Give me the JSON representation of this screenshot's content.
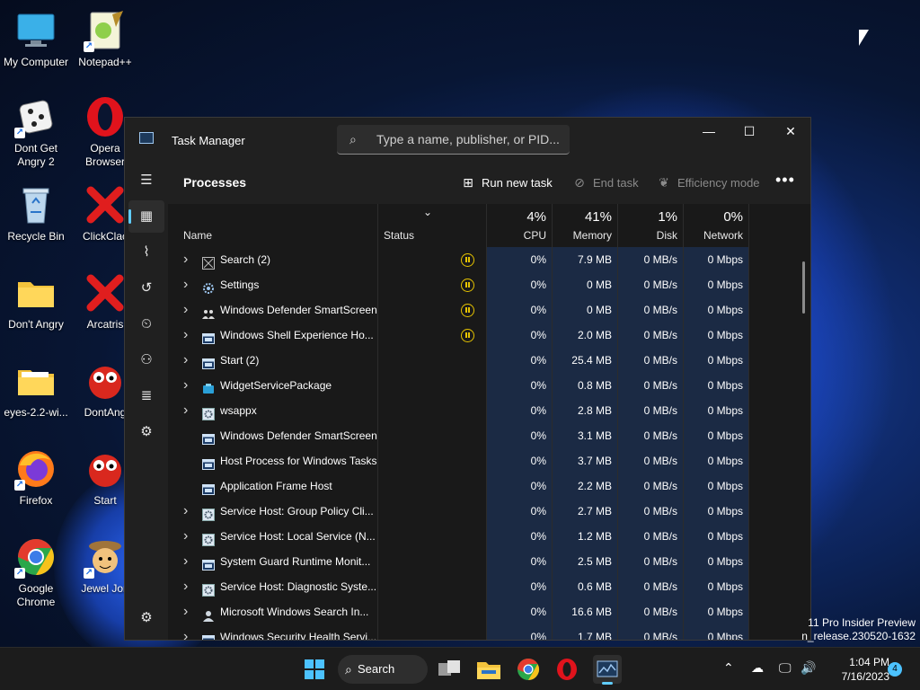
{
  "desktop": {
    "icons": [
      {
        "label": "My Computer"
      },
      {
        "label": "Notepad++"
      },
      {
        "label": "Dont Get Angry 2"
      },
      {
        "label": "Opera Browser"
      },
      {
        "label": "Recycle Bin"
      },
      {
        "label": "ClickClac"
      },
      {
        "label": "Don't Angry"
      },
      {
        "label": "Arcatris"
      },
      {
        "label": "eyes-2.2-wi..."
      },
      {
        "label": "DontAng"
      },
      {
        "label": "Firefox"
      },
      {
        "label": "Start"
      },
      {
        "label": "Google Chrome"
      },
      {
        "label": "Jewel Jon"
      }
    ],
    "watermark_line1": "11 Pro Insider Preview",
    "watermark_line2": "n_release.230520-1632"
  },
  "window": {
    "title": "Task Manager",
    "search_placeholder": "Type a name, publisher, or PID...",
    "minimize": "—",
    "maximize": "☐",
    "close": "✕"
  },
  "nav": {
    "items": [
      "menu-icon",
      "processes-icon",
      "performance-icon",
      "app-history-icon",
      "startup-apps-icon",
      "users-icon",
      "details-icon",
      "services-icon",
      "settings-icon"
    ]
  },
  "toolbar": {
    "heading": "Processes",
    "run_new_task": "Run new task",
    "end_task": "End task",
    "efficiency_mode": "Efficiency mode",
    "more": "•••"
  },
  "columns": {
    "name": "Name",
    "status": "Status",
    "cpu_pct": "4%",
    "cpu": "CPU",
    "memory_pct": "41%",
    "memory": "Memory",
    "disk_pct": "1%",
    "disk": "Disk",
    "network_pct": "0%",
    "network": "Network"
  },
  "processes": [
    {
      "name": "Search (2)",
      "expandable": true,
      "suspended": true,
      "icon": "search-app-icon",
      "cpu": "0%",
      "memory": "7.9 MB",
      "disk": "0 MB/s",
      "network": "0 Mbps"
    },
    {
      "name": "Settings",
      "expandable": true,
      "suspended": true,
      "icon": "settings-app-icon",
      "cpu": "0%",
      "memory": "0 MB",
      "disk": "0 MB/s",
      "network": "0 Mbps"
    },
    {
      "name": "Windows Defender SmartScreen",
      "expandable": true,
      "suspended": true,
      "icon": "defender-icon",
      "cpu": "0%",
      "memory": "0 MB",
      "disk": "0 MB/s",
      "network": "0 Mbps"
    },
    {
      "name": "Windows Shell Experience Ho...",
      "expandable": true,
      "suspended": true,
      "icon": "window-app-icon",
      "cpu": "0%",
      "memory": "2.0 MB",
      "disk": "0 MB/s",
      "network": "0 Mbps"
    },
    {
      "name": "Start (2)",
      "expandable": true,
      "suspended": false,
      "icon": "window-app-icon",
      "cpu": "0%",
      "memory": "25.4 MB",
      "disk": "0 MB/s",
      "network": "0 Mbps"
    },
    {
      "name": "WidgetServicePackage",
      "expandable": true,
      "suspended": false,
      "icon": "widget-icon",
      "cpu": "0%",
      "memory": "0.8 MB",
      "disk": "0 MB/s",
      "network": "0 Mbps"
    },
    {
      "name": "wsappx",
      "expandable": true,
      "suspended": false,
      "icon": "service-gear-icon",
      "cpu": "0%",
      "memory": "2.8 MB",
      "disk": "0 MB/s",
      "network": "0 Mbps"
    },
    {
      "name": "Windows Defender SmartScreen",
      "expandable": false,
      "suspended": false,
      "icon": "window-app-icon",
      "cpu": "0%",
      "memory": "3.1 MB",
      "disk": "0 MB/s",
      "network": "0 Mbps"
    },
    {
      "name": "Host Process for Windows Tasks",
      "expandable": false,
      "suspended": false,
      "icon": "window-app-icon",
      "cpu": "0%",
      "memory": "3.7 MB",
      "disk": "0 MB/s",
      "network": "0 Mbps"
    },
    {
      "name": "Application Frame Host",
      "expandable": false,
      "suspended": false,
      "icon": "window-app-icon",
      "cpu": "0%",
      "memory": "2.2 MB",
      "disk": "0 MB/s",
      "network": "0 Mbps"
    },
    {
      "name": "Service Host: Group Policy Cli...",
      "expandable": true,
      "suspended": false,
      "icon": "service-gear-icon",
      "cpu": "0%",
      "memory": "2.7 MB",
      "disk": "0 MB/s",
      "network": "0 Mbps"
    },
    {
      "name": "Service Host: Local Service (N...",
      "expandable": true,
      "suspended": false,
      "icon": "service-gear-icon",
      "cpu": "0%",
      "memory": "1.2 MB",
      "disk": "0 MB/s",
      "network": "0 Mbps"
    },
    {
      "name": "System Guard Runtime Monit...",
      "expandable": true,
      "suspended": false,
      "icon": "window-app-icon",
      "cpu": "0%",
      "memory": "2.5 MB",
      "disk": "0 MB/s",
      "network": "0 Mbps"
    },
    {
      "name": "Service Host: Diagnostic Syste...",
      "expandable": true,
      "suspended": false,
      "icon": "service-gear-icon",
      "cpu": "0%",
      "memory": "0.6 MB",
      "disk": "0 MB/s",
      "network": "0 Mbps"
    },
    {
      "name": "Microsoft Windows Search In...",
      "expandable": true,
      "suspended": false,
      "icon": "search-indexer-icon",
      "cpu": "0%",
      "memory": "16.6 MB",
      "disk": "0 MB/s",
      "network": "0 Mbps"
    },
    {
      "name": "Windows Security Health Servi...",
      "expandable": true,
      "suspended": false,
      "icon": "window-app-icon",
      "cpu": "0%",
      "memory": "1.7 MB",
      "disk": "0 MB/s",
      "network": "0 Mbps"
    }
  ],
  "taskbar": {
    "search_label": "Search",
    "time": "1:04 PM",
    "date": "7/16/2023",
    "notifications": "4",
    "colors": {
      "accent": "#60cdff",
      "usage_col": "#1b2a44",
      "suspended": "#e6c300"
    }
  }
}
